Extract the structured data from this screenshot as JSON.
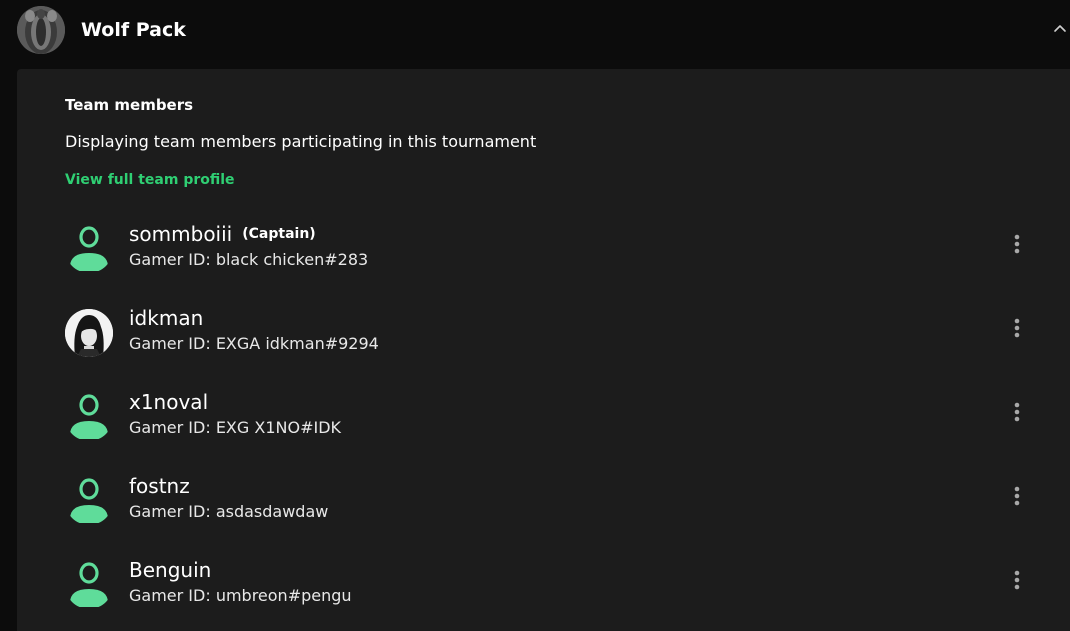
{
  "team": {
    "name": "Wolf Pack",
    "avatar_icon": "team-logo"
  },
  "panel": {
    "title": "Team members",
    "description": "Displaying team members participating in this tournament",
    "profile_link": "View full team profile"
  },
  "colors": {
    "accent": "#2fcf73",
    "default_avatar": "#5fdc9a",
    "panel_bg": "#1c1c1c",
    "page_bg": "#0c0c0c"
  },
  "members": [
    {
      "name": "sommboiii",
      "role": "(Captain)",
      "gamer_id": "Gamer ID: black chicken#283",
      "avatar": "default-user-icon"
    },
    {
      "name": "idkman",
      "role": "",
      "gamer_id": "Gamer ID: EXGA idkman#9294",
      "avatar": "user-photo"
    },
    {
      "name": "x1noval",
      "role": "",
      "gamer_id": "Gamer ID: EXG X1NO#IDK",
      "avatar": "default-user-icon"
    },
    {
      "name": "fostnz",
      "role": "",
      "gamer_id": "Gamer ID: asdasdawdaw",
      "avatar": "default-user-icon"
    },
    {
      "name": "Benguin",
      "role": "",
      "gamer_id": "Gamer ID: umbreon#pengu",
      "avatar": "default-user-icon"
    }
  ]
}
